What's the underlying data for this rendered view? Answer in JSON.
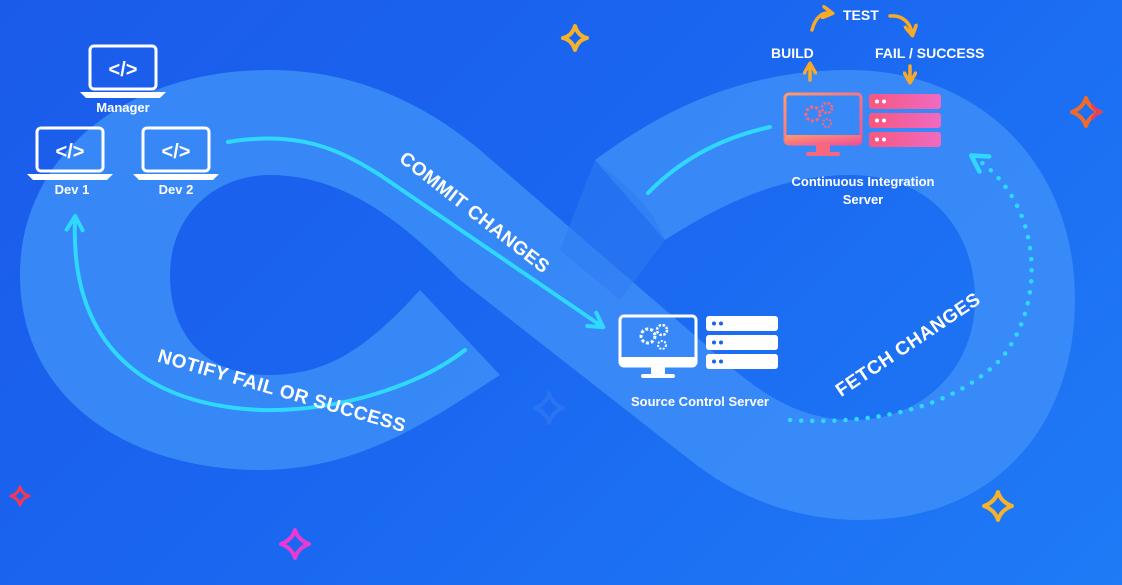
{
  "actors": {
    "manager": "Manager",
    "dev1": "Dev 1",
    "dev2": "Dev 2"
  },
  "servers": {
    "source_control": "Source Control Server",
    "ci_line1": "Continuous Integration",
    "ci_line2": "Server"
  },
  "flows": {
    "commit": "COMMIT CHANGES",
    "fetch": "FETCH CHANGES",
    "notify": "NOTIFY FAIL OR SUCCESS"
  },
  "ci_steps": {
    "build": "BUILD",
    "test": "TEST",
    "result": "FAIL / SUCCESS"
  },
  "colors": {
    "background": "#1b5bea",
    "loop_band": "#3d8ef8",
    "arrow": "#2ed8ff",
    "ci_monitor": "#f7677e",
    "ci_server": "#f25b9e",
    "step_arrow": "#f7a928",
    "sparkle_yellow": "#f7b22b",
    "sparkle_red": "#f0385a",
    "sparkle_magenta": "#e93ad8"
  },
  "icons": {
    "laptop": "code-laptop-icon",
    "monitor": "gear-monitor-icon",
    "server": "server-rack-icon",
    "sparkle": "sparkle-icon"
  }
}
